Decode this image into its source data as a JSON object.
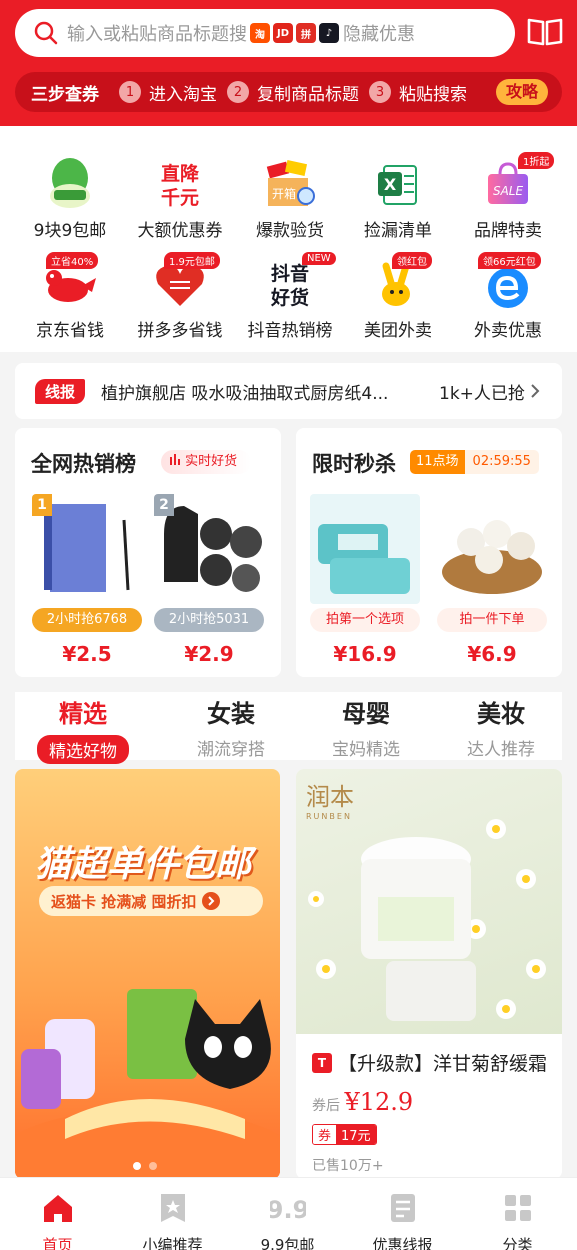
{
  "header": {
    "search_placeholder": "输入或粘贴商品标题搜",
    "search_suffix": "隐藏优惠",
    "platform_icons": [
      {
        "name": "taobao-icon",
        "glyph": "淘",
        "color": "#ff5000"
      },
      {
        "name": "jd-icon",
        "glyph": "JD",
        "color": "#e1251b"
      },
      {
        "name": "pinduoduo-icon",
        "glyph": "拼",
        "color": "#e02e24"
      },
      {
        "name": "douyin-icon",
        "glyph": "♪",
        "color": "#161823"
      }
    ],
    "steps_title": "三步查券",
    "steps": [
      {
        "num": "1",
        "label": "进入淘宝"
      },
      {
        "num": "2",
        "label": "复制商品标题"
      },
      {
        "num": "3",
        "label": "粘贴搜索"
      }
    ],
    "guide_button": "攻略"
  },
  "grid": [
    {
      "label": "9块9包邮",
      "badge": "",
      "icon": "baicai-icon"
    },
    {
      "label": "大额优惠券",
      "badge": "",
      "icon": "big-discount-icon",
      "icon_text_1": "直降",
      "icon_text_2": "千元"
    },
    {
      "label": "爆款验货",
      "badge": "",
      "icon": "inspection-box-icon",
      "icon_text": "开箱"
    },
    {
      "label": "捡漏清单",
      "badge": "",
      "icon": "excel-list-icon"
    },
    {
      "label": "品牌特卖",
      "badge": "1折起",
      "icon": "sale-bag-icon",
      "icon_text": "SALE"
    },
    {
      "label": "京东省钱",
      "badge": "立省40%",
      "icon": "jd-dog-icon"
    },
    {
      "label": "拼多多省钱",
      "badge": "1.9元包邮",
      "icon": "pdd-heart-icon"
    },
    {
      "label": "抖音热销榜",
      "badge": "NEW",
      "icon": "douyin-hot-icon",
      "icon_text_1": "抖音",
      "icon_text_2": "好货"
    },
    {
      "label": "美团外卖",
      "badge": "领红包",
      "icon": "meituan-kangaroo-icon"
    },
    {
      "label": "外卖优惠",
      "badge": "领66元红包",
      "icon": "eleme-icon"
    }
  ],
  "news": {
    "tag": "线报",
    "text": "植护旗舰店 吸水吸油抽取式厨房纸4...",
    "count": "1k+人已抢"
  },
  "hot_list": {
    "title": "全网热销榜",
    "tag": "实时好货",
    "items": [
      {
        "rank": "1",
        "pill": "2小时抢6768",
        "price": "¥2.5"
      },
      {
        "rank": "2",
        "pill": "2小时抢5031",
        "price": "¥2.9"
      }
    ]
  },
  "flash_sale": {
    "title": "限时秒杀",
    "slot": "11点场",
    "countdown": "02:59:55",
    "items": [
      {
        "pill": "拍第一个选项",
        "price": "¥16.9"
      },
      {
        "pill": "拍一件下单",
        "price": "¥6.9"
      }
    ]
  },
  "tabs": [
    {
      "main": "精选",
      "sub": "精选好物",
      "active": true
    },
    {
      "main": "女装",
      "sub": "潮流穿搭",
      "active": false
    },
    {
      "main": "母婴",
      "sub": "宝妈精选",
      "active": false
    },
    {
      "main": "美妆",
      "sub": "达人推荐",
      "active": false
    }
  ],
  "banner": {
    "headline": "猫超单件包邮",
    "subline": "返猫卡 抢满减 囤折扣"
  },
  "product": {
    "brand_text": "润本",
    "brand_sub": "RUNBEN",
    "platform_badge": "T",
    "title": "【升级款】洋甘菊舒缓霜",
    "price_label": "券后",
    "price": "¥12.9",
    "coupon_label": "券",
    "coupon_value": "17元",
    "sold": "已售10万+"
  },
  "nav": [
    {
      "label": "首页",
      "icon": "home-icon",
      "active": true
    },
    {
      "label": "小编推荐",
      "icon": "editor-pick-icon",
      "active": false
    },
    {
      "label": "9.9包邮",
      "icon": "nine-nine-icon",
      "active": false
    },
    {
      "label": "优惠线报",
      "icon": "deal-news-icon",
      "active": false
    },
    {
      "label": "分类",
      "icon": "category-icon",
      "active": false
    }
  ],
  "colors": {
    "brand": "#ea1d26",
    "accent": "#ff8a00"
  }
}
